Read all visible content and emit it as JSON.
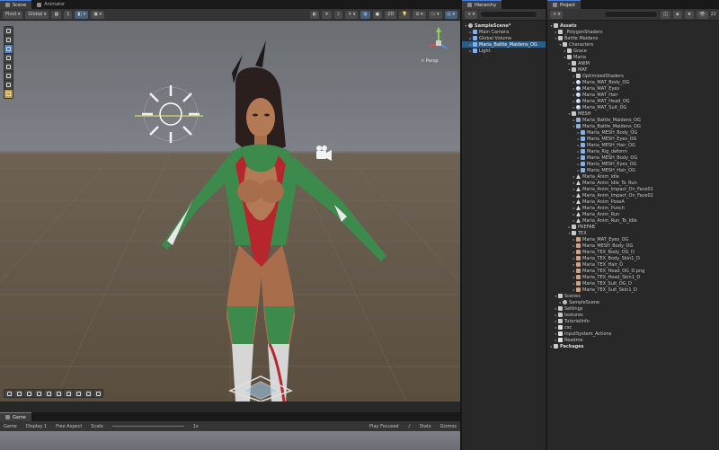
{
  "scene_tabs": [
    "Scene",
    "Animator"
  ],
  "scene_toolbar": {
    "pivot": "Pivot",
    "space": "Global",
    "snap": "1",
    "persp": "< Persp"
  },
  "hierarchy": {
    "tab": "Hierarchy",
    "items": [
      {
        "label": "SampleScene*",
        "depth": 0,
        "icon": "scene",
        "bold": true,
        "expanded": true
      },
      {
        "label": "Main Camera",
        "depth": 1,
        "icon": "obj"
      },
      {
        "label": "Global Volume",
        "depth": 1,
        "icon": "obj"
      },
      {
        "label": "Maria_Battle_Maidens_OG",
        "depth": 1,
        "icon": "obj",
        "highlight": true,
        "selected": true
      },
      {
        "label": "Light",
        "depth": 1,
        "icon": "obj"
      }
    ]
  },
  "project": {
    "tab": "Project",
    "count": "22",
    "items": [
      {
        "label": "Assets",
        "depth": 0,
        "icon": "folder",
        "bold": true,
        "expanded": true
      },
      {
        "label": "_PolygonShaders",
        "depth": 1,
        "icon": "folder"
      },
      {
        "label": "Battle Maidens",
        "depth": 1,
        "icon": "folder",
        "expanded": true
      },
      {
        "label": "Characters",
        "depth": 2,
        "icon": "folder",
        "expanded": true
      },
      {
        "label": "Grace",
        "depth": 3,
        "icon": "folder"
      },
      {
        "label": "Maria",
        "depth": 3,
        "icon": "folder",
        "expanded": true
      },
      {
        "label": "ANIM",
        "depth": 4,
        "icon": "folder"
      },
      {
        "label": "MAT",
        "depth": 4,
        "icon": "folder",
        "expanded": true
      },
      {
        "label": "OptimizedShaders",
        "depth": 5,
        "icon": "folder"
      },
      {
        "label": "Maria_MAT_Body_OG",
        "depth": 5,
        "icon": "mat"
      },
      {
        "label": "Maria_MAT_Eyes",
        "depth": 5,
        "icon": "mat"
      },
      {
        "label": "Maria_MAT_Hair",
        "depth": 5,
        "icon": "mat"
      },
      {
        "label": "Maria_MAT_Head_OG",
        "depth": 5,
        "icon": "mat"
      },
      {
        "label": "Maria_MAT_Suit_OG",
        "depth": 5,
        "icon": "mat"
      },
      {
        "label": "MESH",
        "depth": 4,
        "icon": "folder",
        "expanded": true
      },
      {
        "label": "Maria_Battle_Maidens_OG",
        "depth": 5,
        "icon": "mesh"
      },
      {
        "label": "Maria_Battle_Maidens_OG",
        "depth": 5,
        "icon": "mesh",
        "expanded": true
      },
      {
        "label": "Maria_MESH_Body_OG",
        "depth": 6,
        "icon": "mesh"
      },
      {
        "label": "Maria_MESH_Eyes_OG",
        "depth": 6,
        "icon": "mesh"
      },
      {
        "label": "Maria_MESH_Hair_OG",
        "depth": 6,
        "icon": "mesh"
      },
      {
        "label": "Maria_Rig_deform",
        "depth": 6,
        "icon": "mesh"
      },
      {
        "label": "Maria_MESH_Body_OG",
        "depth": 6,
        "icon": "mesh"
      },
      {
        "label": "Maria_MESH_Eyes_OG",
        "depth": 6,
        "icon": "mesh"
      },
      {
        "label": "Maria_MESH_Hair_OG",
        "depth": 6,
        "icon": "mesh"
      },
      {
        "label": "Maria_Anim_Idle",
        "depth": 5,
        "icon": "anim"
      },
      {
        "label": "Maria_Anim_Idle_To_Run",
        "depth": 5,
        "icon": "anim"
      },
      {
        "label": "Maria_Anim_Impact_On_Face01",
        "depth": 5,
        "icon": "anim"
      },
      {
        "label": "Maria_Anim_Impact_On_Face02",
        "depth": 5,
        "icon": "anim"
      },
      {
        "label": "Maria_Anim_PoseA",
        "depth": 5,
        "icon": "anim"
      },
      {
        "label": "Maria_Anim_Punch",
        "depth": 5,
        "icon": "anim"
      },
      {
        "label": "Maria_Anim_Run",
        "depth": 5,
        "icon": "anim"
      },
      {
        "label": "Maria_Anim_Run_To_Idle",
        "depth": 5,
        "icon": "anim"
      },
      {
        "label": "PREFAB",
        "depth": 4,
        "icon": "folder"
      },
      {
        "label": "TEX",
        "depth": 4,
        "icon": "folder",
        "expanded": true
      },
      {
        "label": "Maria_MAT_Eyes_OG",
        "depth": 5,
        "icon": "tex"
      },
      {
        "label": "Maria_MESH_Body_OG",
        "depth": 5,
        "icon": "tex"
      },
      {
        "label": "Maria_TEX_Body_OG_D",
        "depth": 5,
        "icon": "tex"
      },
      {
        "label": "Maria_TEX_Body_Skin1_D",
        "depth": 5,
        "icon": "tex"
      },
      {
        "label": "Maria_TEX_Hair_D",
        "depth": 5,
        "icon": "tex"
      },
      {
        "label": "Maria_TEX_Head_OG_D.png",
        "depth": 5,
        "icon": "tex"
      },
      {
        "label": "Maria_TEX_Head_Skin1_D",
        "depth": 5,
        "icon": "tex"
      },
      {
        "label": "Maria_TEX_Suit_OG_D",
        "depth": 5,
        "icon": "tex"
      },
      {
        "label": "Maria_TEX_Suit_Skin1_D",
        "depth": 5,
        "icon": "tex"
      },
      {
        "label": "Scenes",
        "depth": 1,
        "icon": "folder",
        "expanded": true
      },
      {
        "label": "SampleScene",
        "depth": 2,
        "icon": "scene"
      },
      {
        "label": "Settings",
        "depth": 1,
        "icon": "folder"
      },
      {
        "label": "textures",
        "depth": 1,
        "icon": "folder"
      },
      {
        "label": "TutorialInfo",
        "depth": 1,
        "icon": "folder"
      },
      {
        "label": "csc",
        "depth": 1,
        "icon": "file"
      },
      {
        "label": "InputSystem_Actions",
        "depth": 1,
        "icon": "file"
      },
      {
        "label": "Readme",
        "depth": 1,
        "icon": "file"
      },
      {
        "label": "Packages",
        "depth": 0,
        "icon": "folder",
        "bold": true
      }
    ]
  },
  "game": {
    "tab": "Game",
    "display_mode": "Game",
    "display": "Display 1",
    "aspect": "Free Aspect",
    "scale_label": "Scale",
    "scale_value": "1x",
    "play_mode": "Play Focused",
    "stats": "Stats",
    "gizmos": "Gizmos"
  }
}
